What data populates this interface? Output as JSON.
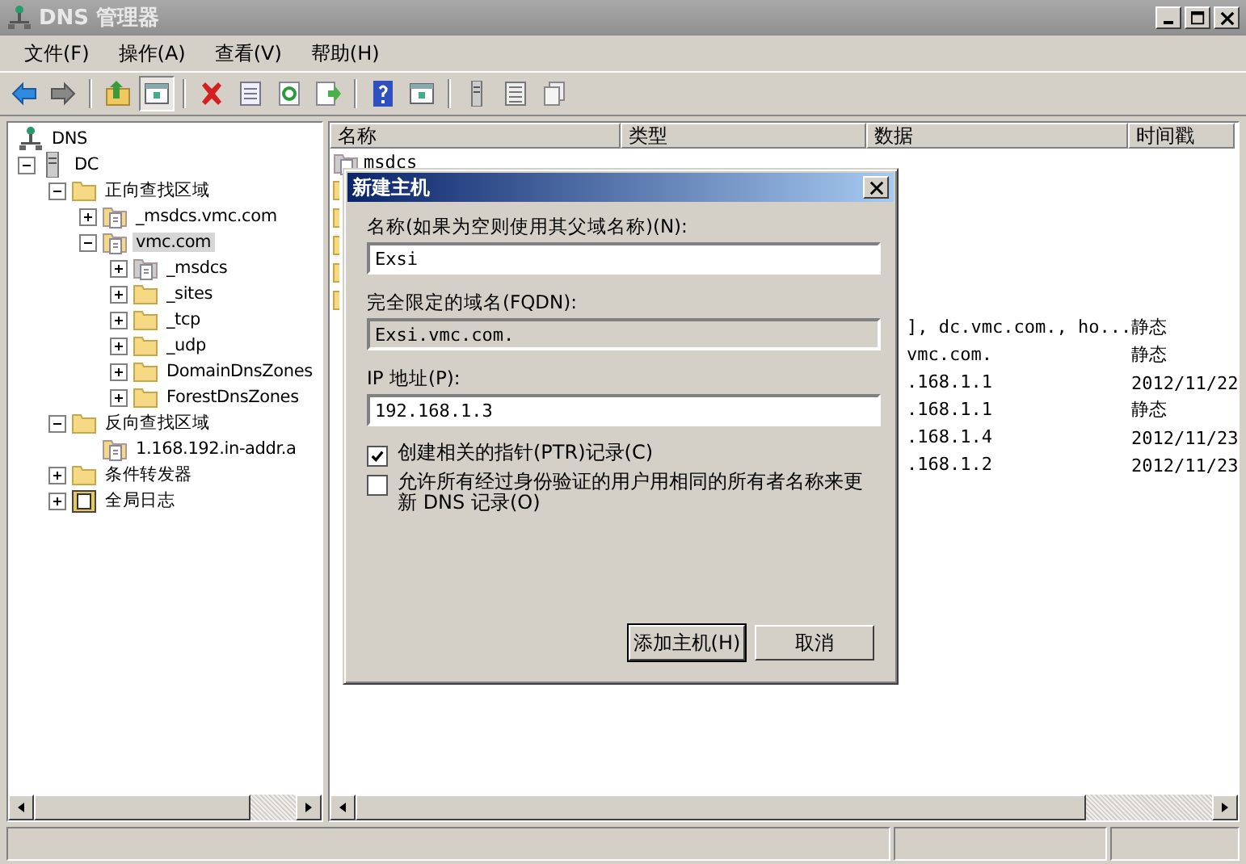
{
  "window": {
    "title": "DNS 管理器",
    "active": false
  },
  "menu": [
    "文件(F)",
    "操作(A)",
    "查看(V)",
    "帮助(H)"
  ],
  "toolbar": [
    {
      "kind": "back"
    },
    {
      "kind": "forward"
    },
    {
      "kind": "sep"
    },
    {
      "kind": "up"
    },
    {
      "kind": "pane",
      "selected": true
    },
    {
      "kind": "sep"
    },
    {
      "kind": "delete"
    },
    {
      "kind": "props"
    },
    {
      "kind": "refresh"
    },
    {
      "kind": "export"
    },
    {
      "kind": "sep"
    },
    {
      "kind": "help"
    },
    {
      "kind": "pane2",
      "selected": false
    },
    {
      "kind": "sep"
    },
    {
      "kind": "server"
    },
    {
      "kind": "list"
    },
    {
      "kind": "copy"
    }
  ],
  "tree": [
    {
      "label": "DNS",
      "kind": "dns",
      "selected": false,
      "children": [
        {
          "label": "DC",
          "kind": "server",
          "expanded": true,
          "selected": false,
          "children": [
            {
              "label": "正向查找区域",
              "kind": "folder",
              "expanded": true,
              "selected": false,
              "children": [
                {
                  "label": "_msdcs.vmc.com",
                  "kind": "zone",
                  "expanded": false,
                  "selected": false
                },
                {
                  "label": "vmc.com",
                  "kind": "zone",
                  "expanded": true,
                  "selected": true,
                  "children": [
                    {
                      "label": "_msdcs",
                      "kind": "zone-grey",
                      "expanded": false,
                      "selected": false
                    },
                    {
                      "label": "_sites",
                      "kind": "folder",
                      "expanded": false,
                      "selected": false
                    },
                    {
                      "label": "_tcp",
                      "kind": "folder",
                      "expanded": false,
                      "selected": false
                    },
                    {
                      "label": "_udp",
                      "kind": "folder",
                      "expanded": false,
                      "selected": false
                    },
                    {
                      "label": "DomainDnsZones",
                      "kind": "folder",
                      "expanded": false,
                      "selected": false
                    },
                    {
                      "label": "ForestDnsZones",
                      "kind": "folder",
                      "expanded": false,
                      "selected": false
                    }
                  ]
                }
              ]
            },
            {
              "label": "反向查找区域",
              "kind": "folder",
              "expanded": true,
              "selected": false,
              "children": [
                {
                  "label": "1.168.192.in-addr.a",
                  "kind": "zone",
                  "selected": false
                }
              ]
            },
            {
              "label": "条件转发器",
              "kind": "folder",
              "expanded": false,
              "selected": false
            },
            {
              "label": "全局日志",
              "kind": "log",
              "expanded": false,
              "selected": false
            }
          ]
        }
      ]
    }
  ],
  "list": {
    "columns": [
      "名称",
      "类型",
      "数据",
      "时间戳"
    ],
    "rows": [
      {
        "kind": "zone-grey",
        "name": "msdcs"
      },
      {
        "kind": "folder"
      },
      {
        "kind": "folder"
      },
      {
        "kind": "folder"
      },
      {
        "kind": "folder"
      },
      {
        "kind": "folder"
      },
      {
        "kind": "record",
        "data": "], dc.vmc.com., ho...",
        "time": "静态"
      },
      {
        "kind": "record",
        "data": "vmc.com.",
        "time": "静态"
      },
      {
        "kind": "record",
        "data": ".168.1.1",
        "time": "2012/11/22"
      },
      {
        "kind": "record",
        "data": ".168.1.1",
        "time": "静态"
      },
      {
        "kind": "record",
        "data": ".168.1.4",
        "time": "2012/11/23"
      },
      {
        "kind": "record",
        "data": ".168.1.2",
        "time": "2012/11/23"
      }
    ]
  },
  "dialog": {
    "title": "新建主机",
    "fields": [
      {
        "label": "名称(如果为空则使用其父域名称)(N):",
        "value": "Exsi",
        "disabled": false
      },
      {
        "label": "完全限定的域名(FQDN):",
        "value": "Exsi.vmc.com.",
        "disabled": true
      },
      {
        "label": "IP 地址(P):",
        "value": "192.168.1.3",
        "disabled": false
      }
    ],
    "checkboxes": [
      {
        "label": "创建相关的指针(PTR)记录(C)",
        "checked": true
      },
      {
        "label": "允许所有经过身份验证的用户用相同的所有者名称来更新 DNS 记录(O)",
        "checked": false
      }
    ],
    "buttons": [
      {
        "label": "添加主机(H)",
        "default": true
      },
      {
        "label": "取消",
        "default": false
      }
    ]
  }
}
